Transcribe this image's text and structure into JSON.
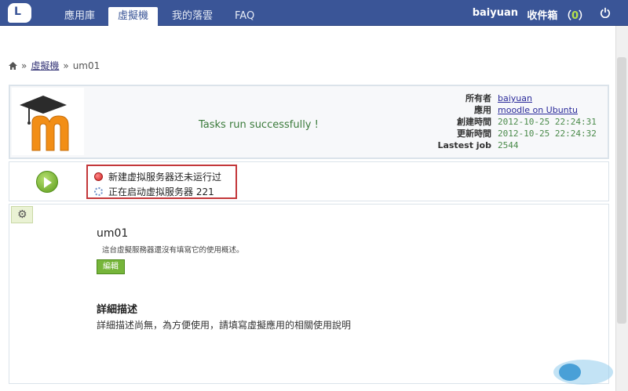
{
  "nav": {
    "tabs": [
      "應用庫",
      "虛擬機",
      "我的落雲",
      "FAQ"
    ],
    "active_tab": "虛擬機",
    "user": "baiyuan",
    "inbox_label": "收件箱",
    "inbox_count": "0"
  },
  "breadcrumb": {
    "parent": "虛擬機",
    "current": "um01"
  },
  "info": {
    "message": "Tasks run successfully !",
    "owner_label": "所有者",
    "owner": "baiyuan",
    "app_label": "應用",
    "app": "moodle on Ubuntu",
    "created_label": "創建時間",
    "created": "2012-10-25 22:24:31",
    "updated_label": "更新時間",
    "updated": "2012-10-25 22:24:32",
    "job_label": "Lastest job",
    "job": "2544"
  },
  "status": {
    "line1": "新建虚拟服务器还未运行过",
    "line2": "正在启动虚拟服务器 221"
  },
  "detail": {
    "name": "um01",
    "desc": "這台虛擬服務器還沒有填寫它的使用概述。",
    "edit_label": "編輯",
    "heading": "詳細描述",
    "text": "詳細描述尚無，為方便使用，請填寫虛擬應用的相關使用說明"
  },
  "colors": {
    "nav_bg": "#3a5597",
    "highlight": "#c3373a",
    "accent_green": "#76b53a"
  }
}
